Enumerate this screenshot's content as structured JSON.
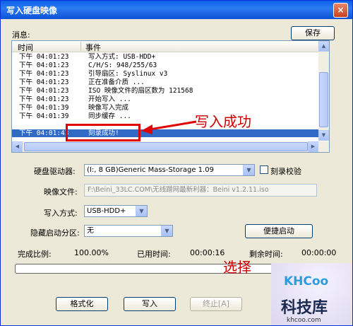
{
  "window": {
    "title": "写入硬盘映像",
    "close_glyph": "×"
  },
  "messages": {
    "label": "消息:",
    "save_button": "保存",
    "columns": [
      "时间",
      "事件"
    ],
    "rows": [
      {
        "time": "下午 04:01:23",
        "event": "写入方式: USB-HDD+"
      },
      {
        "time": "下午 04:01:23",
        "event": "C/H/S: 948/255/63"
      },
      {
        "time": "下午 04:01:23",
        "event": "引导扇区: Syslinux v3"
      },
      {
        "time": "下午 04:01:23",
        "event": "正在准备介质 ..."
      },
      {
        "time": "下午 04:01:23",
        "event": "ISO 映像文件的扇区数为 121568"
      },
      {
        "time": "下午 04:01:23",
        "event": "开始写入 ..."
      },
      {
        "time": "下午 04:01:39",
        "event": "映像写入完成"
      },
      {
        "time": "下午 04:01:39",
        "event": "同步缓存 ..."
      },
      {
        "time": "",
        "event": ""
      },
      {
        "time": "下午 04:01:43",
        "event": "刻录成功!",
        "selected": true
      }
    ]
  },
  "form": {
    "drive_label": "硬盘驱动器:",
    "drive_value": "(I:, 8 GB)Generic Mass-Storage     1.09",
    "verify_label": "刻录校验",
    "image_label": "映像文件:",
    "image_value": "F:\\Beini_33LC.COM\\无线蹭网最新利器：Beini v1.2.11.iso",
    "method_label": "写入方式:",
    "method_value": "USB-HDD+",
    "hide_label": "隐藏启动分区:",
    "hide_value": "无",
    "quick_boot_button": "便捷启动"
  },
  "status": {
    "progress_label": "完成比例:",
    "progress_value": "100.00%",
    "elapsed_label": "已用时间:",
    "elapsed_value": "00:00:16",
    "remaining_label": "剩余时间:",
    "remaining_value": "00:00:00",
    "progress_fraction": 1.0
  },
  "buttons": {
    "format": "格式化",
    "write": "写入",
    "stop": "终止[A]"
  },
  "annotations": {
    "success": "写入成功",
    "choose": "选择"
  },
  "watermark": {
    "brand": "KHCoo",
    "name": "科技库",
    "url": "khcoo.com"
  },
  "colors": {
    "title_bar": "#0a5fe8",
    "selection": "#316ac5",
    "annotation": "#e00000"
  }
}
